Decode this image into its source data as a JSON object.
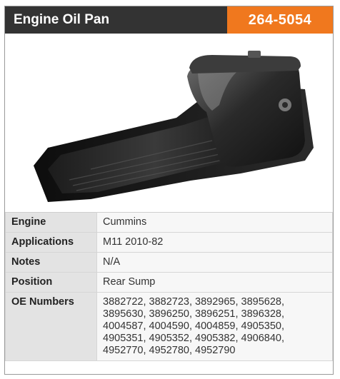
{
  "header": {
    "title": "Engine Oil Pan",
    "part_number": "264-5054",
    "accent_color": "#f0781e",
    "title_bg_color": "#333333"
  },
  "specs": [
    {
      "label": "Engine",
      "value": "Cummins"
    },
    {
      "label": "Applications",
      "value": "M11 2010-82"
    },
    {
      "label": "Notes",
      "value": "N/A"
    },
    {
      "label": "Position",
      "value": "Rear Sump"
    },
    {
      "label": "OE Numbers",
      "value": "3882722, 3882723, 3892965, 3895628, 3895630, 3896250, 3896251, 3896328, 4004587, 4004590, 4004859, 4905350, 4905351, 4905352, 4905382, 4906840, 4952770, 4952780, 4952790"
    }
  ]
}
